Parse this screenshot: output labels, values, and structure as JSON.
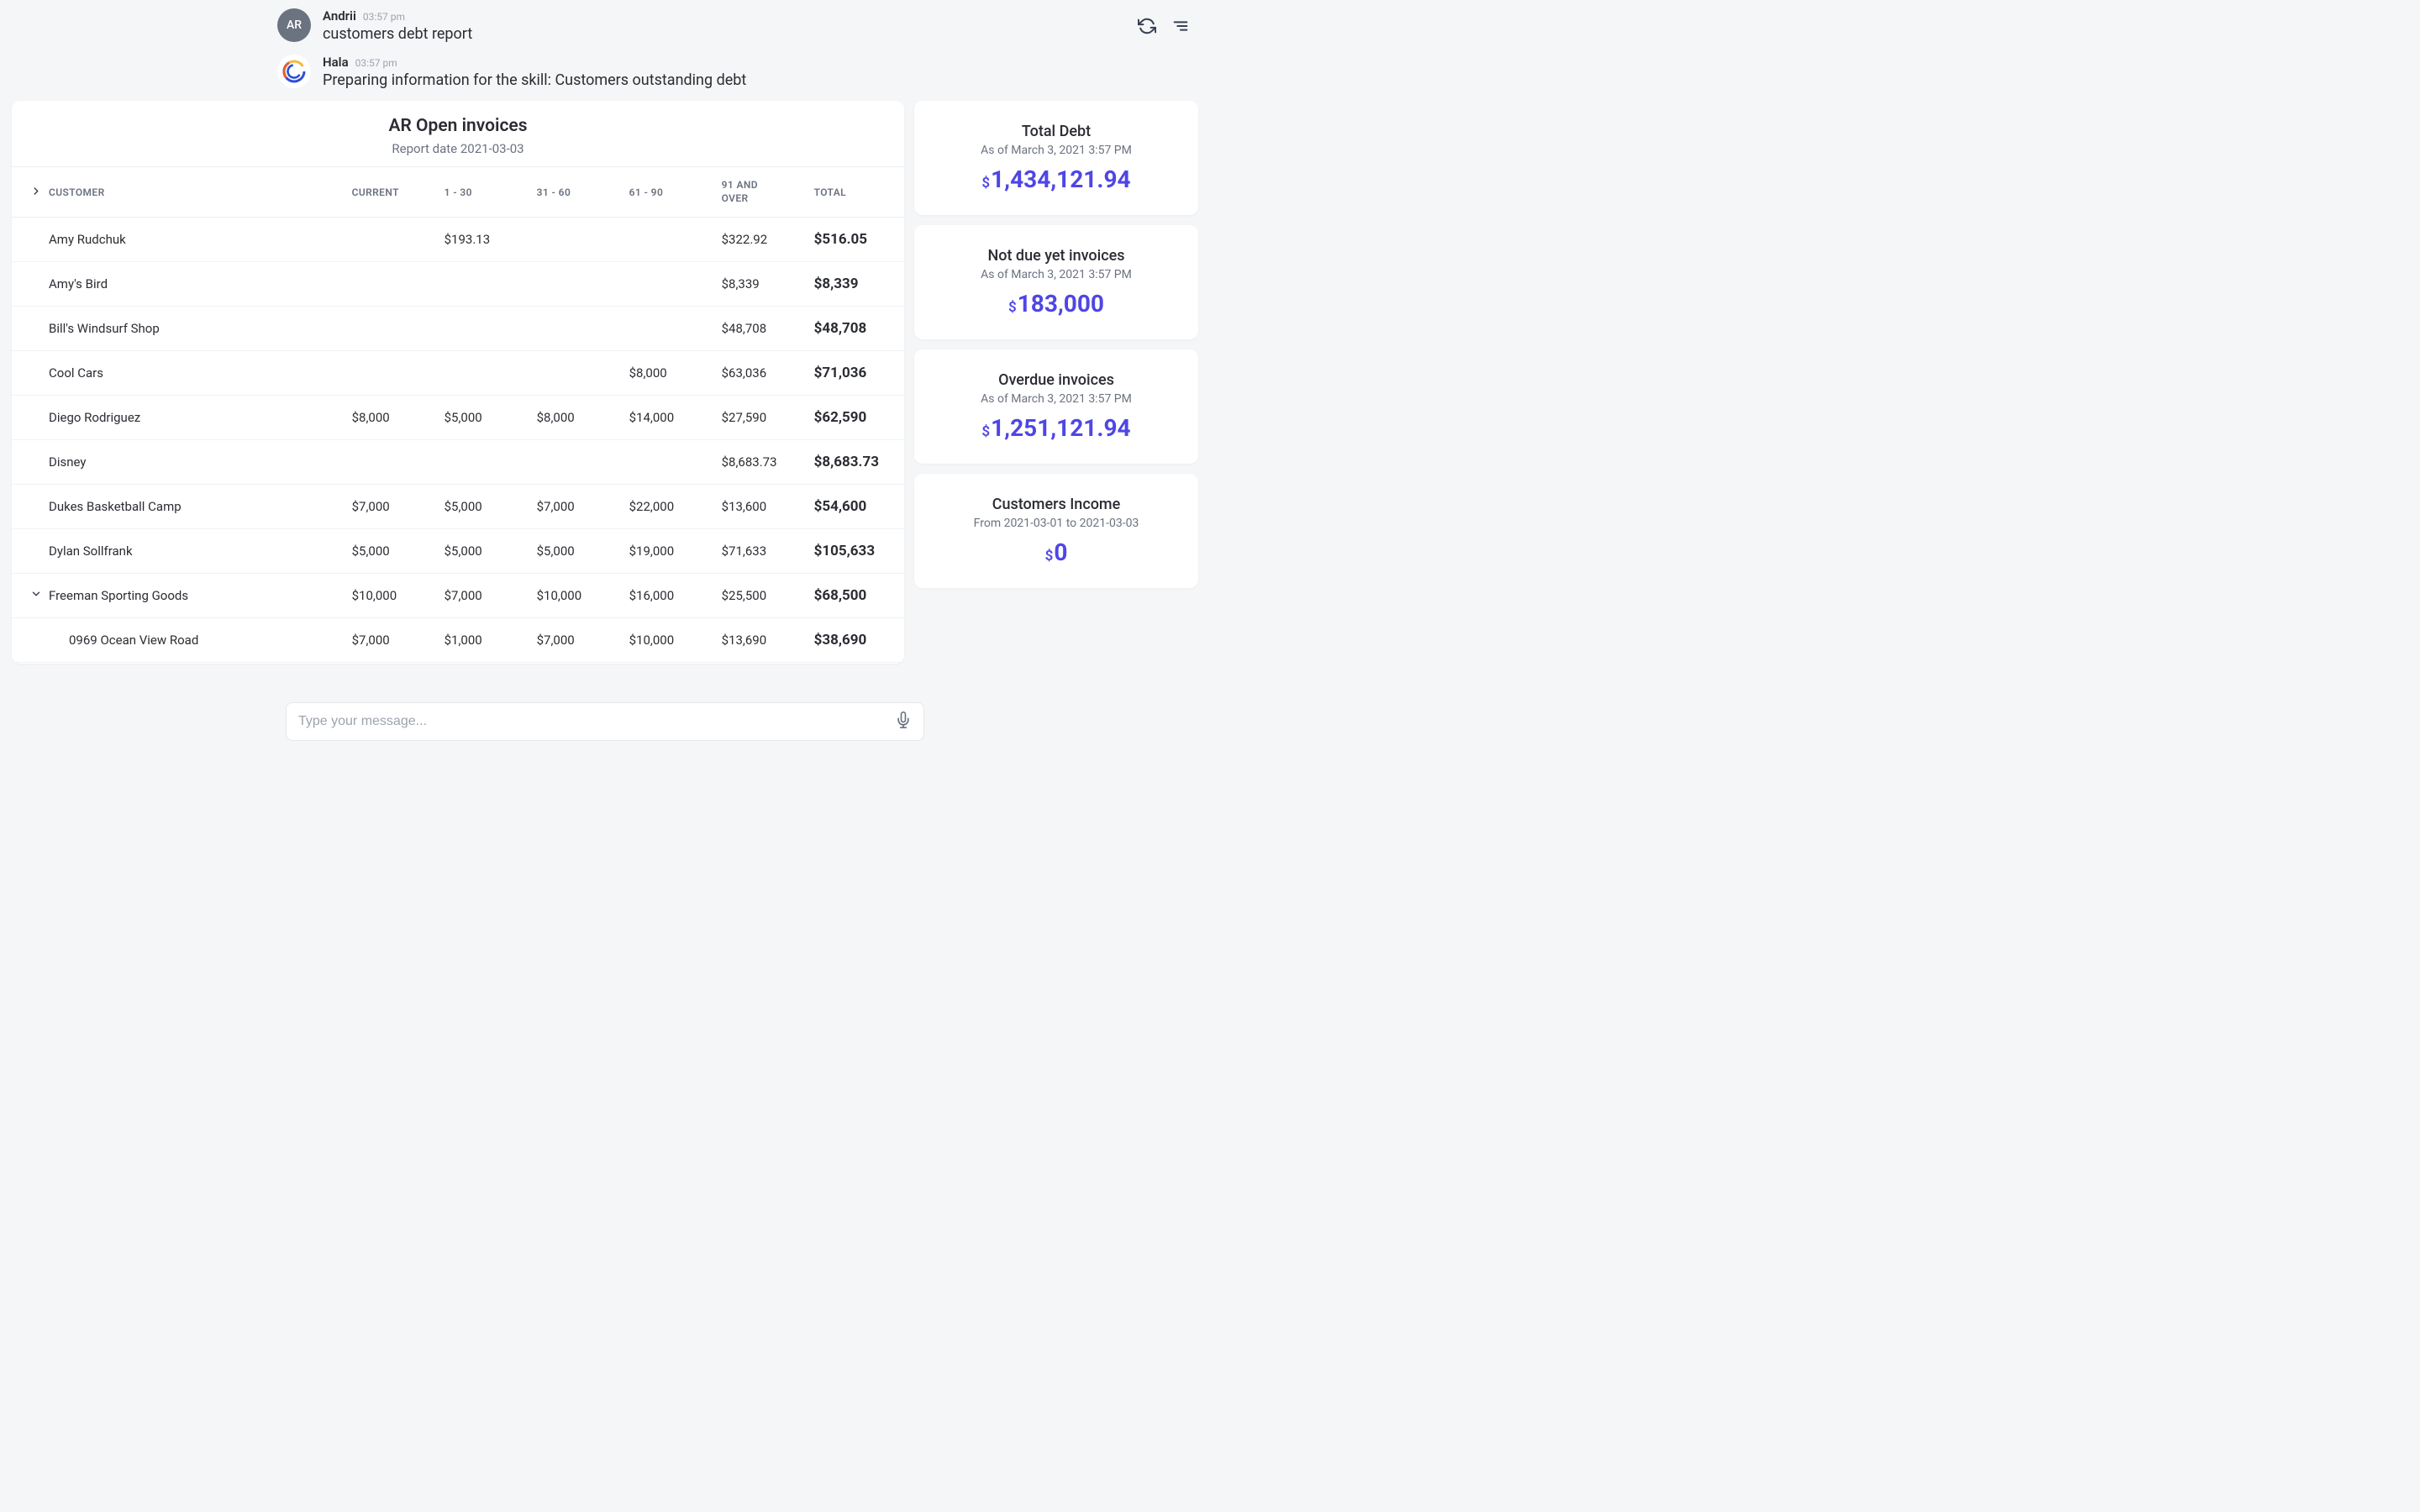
{
  "chat": {
    "user": {
      "initials": "AR",
      "name": "Andrii",
      "time": "03:57 pm",
      "text": "customers debt report"
    },
    "bot": {
      "name": "Hala",
      "time": "03:57 pm",
      "text": "Preparing information for the skill: Customers outstanding debt"
    }
  },
  "report": {
    "title": "AR Open invoices",
    "date_label": "Report date 2021-03-03",
    "columns": {
      "customer": "CUSTOMER",
      "current": "CURRENT",
      "c1_30": "1 - 30",
      "c31_60": "31 - 60",
      "c61_90": "61 - 90",
      "c91": "91 AND OVER",
      "total": "TOTAL"
    },
    "rows": [
      {
        "name": "Amy Rudchuk",
        "current": "",
        "c1_30": "$193.13",
        "c31_60": "",
        "c61_90": "",
        "c91": "$322.92",
        "total": "$516.05"
      },
      {
        "name": "Amy's Bird",
        "current": "",
        "c1_30": "",
        "c31_60": "",
        "c61_90": "",
        "c91": "$8,339",
        "total": "$8,339"
      },
      {
        "name": "Bill's Windsurf Shop",
        "current": "",
        "c1_30": "",
        "c31_60": "",
        "c61_90": "",
        "c91": "$48,708",
        "total": "$48,708"
      },
      {
        "name": "Cool Cars",
        "current": "",
        "c1_30": "",
        "c31_60": "",
        "c61_90": "$8,000",
        "c91": "$63,036",
        "total": "$71,036"
      },
      {
        "name": "Diego Rodriguez",
        "current": "$8,000",
        "c1_30": "$5,000",
        "c31_60": "$8,000",
        "c61_90": "$14,000",
        "c91": "$27,590",
        "total": "$62,590"
      },
      {
        "name": "Disney",
        "current": "",
        "c1_30": "",
        "c31_60": "",
        "c61_90": "",
        "c91": "$8,683.73",
        "total": "$8,683.73"
      },
      {
        "name": "Dukes Basketball Camp",
        "current": "$7,000",
        "c1_30": "$5,000",
        "c31_60": "$7,000",
        "c61_90": "$22,000",
        "c91": "$13,600",
        "total": "$54,600"
      },
      {
        "name": "Dylan Sollfrank",
        "current": "$5,000",
        "c1_30": "$5,000",
        "c31_60": "$5,000",
        "c61_90": "$19,000",
        "c91": "$71,633",
        "total": "$105,633"
      },
      {
        "name": "Freeman Sporting Goods",
        "expandable": true,
        "current": "$10,000",
        "c1_30": "$7,000",
        "c31_60": "$10,000",
        "c61_90": "$16,000",
        "c91": "$25,500",
        "total": "$68,500"
      },
      {
        "name": "0969 Ocean View Road",
        "sub": true,
        "current": "$7,000",
        "c1_30": "$1,000",
        "c31_60": "$7,000",
        "c61_90": "$10,000",
        "c91": "$13,690",
        "total": "$38,690"
      }
    ]
  },
  "stats": [
    {
      "title": "Total Debt",
      "sub": "As of March 3, 2021 3:57 PM",
      "currency": "$",
      "value": "1,434,121.94"
    },
    {
      "title": "Not due yet invoices",
      "sub": "As of March 3, 2021 3:57 PM",
      "currency": "$",
      "value": "183,000"
    },
    {
      "title": "Overdue invoices",
      "sub": "As of March 3, 2021 3:57 PM",
      "currency": "$",
      "value": "1,251,121.94"
    },
    {
      "title": "Customers Income",
      "sub": "From 2021-03-01 to 2021-03-03",
      "currency": "$",
      "value": "0"
    }
  ],
  "input": {
    "placeholder": "Type your message..."
  }
}
